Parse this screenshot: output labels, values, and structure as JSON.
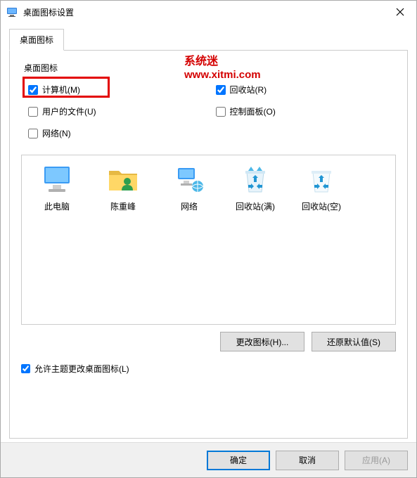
{
  "title": "桌面图标设置",
  "watermark": {
    "line1": "系统迷",
    "line2": "www.xitmi.com"
  },
  "tabs": {
    "active": "桌面图标"
  },
  "group_label": "桌面图标",
  "checkboxes": {
    "computer": {
      "label": "计算机(M)",
      "checked": true
    },
    "recycle": {
      "label": "回收站(R)",
      "checked": true
    },
    "userfiles": {
      "label": "用户的文件(U)",
      "checked": false
    },
    "controlpanel": {
      "label": "控制面板(O)",
      "checked": false
    },
    "network": {
      "label": "网络(N)",
      "checked": false
    }
  },
  "icons": [
    {
      "key": "pc",
      "label": "此电脑"
    },
    {
      "key": "user",
      "label": "陈重峰"
    },
    {
      "key": "net",
      "label": "网络"
    },
    {
      "key": "binfull",
      "label": "回收站(满)"
    },
    {
      "key": "binempty",
      "label": "回收站(空)"
    }
  ],
  "buttons": {
    "change_icon": "更改图标(H)...",
    "restore_default": "还原默认值(S)",
    "ok": "确定",
    "cancel": "取消",
    "apply": "应用(A)"
  },
  "allow_theme": {
    "label": "允许主题更改桌面图标(L)",
    "checked": true
  }
}
